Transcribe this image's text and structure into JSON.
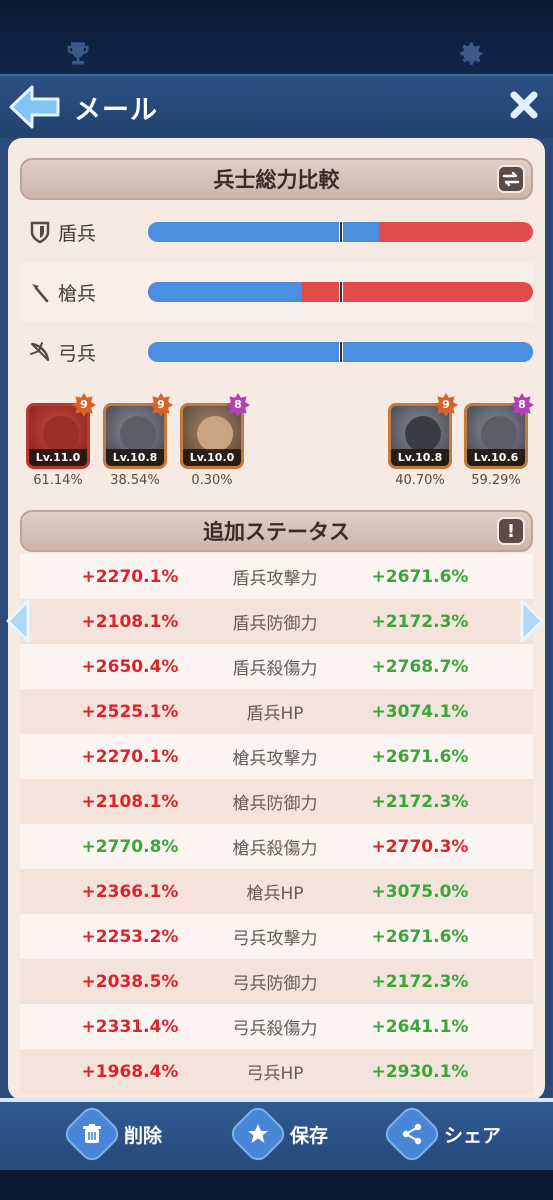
{
  "header": {
    "title": "メール"
  },
  "power_section": {
    "title": "兵士総力比較",
    "rows": [
      {
        "label": "盾兵",
        "icon": "shield-icon",
        "left_share": 0.6
      },
      {
        "label": "槍兵",
        "icon": "spear-icon",
        "left_share": 0.4
      },
      {
        "label": "弓兵",
        "icon": "bow-icon",
        "left_share": 1.0
      }
    ]
  },
  "heroes": {
    "left": [
      {
        "level": "Lv.11.0",
        "stars": "9",
        "pct": "61.14%",
        "star_color": "orange"
      },
      {
        "level": "Lv.10.8",
        "stars": "9",
        "pct": "38.54%",
        "star_color": "orange"
      },
      {
        "level": "Lv.10.0",
        "stars": "8",
        "pct": "0.30%",
        "star_color": "purple"
      }
    ],
    "right": [
      {
        "level": "Lv.10.8",
        "stars": "9",
        "pct": "40.70%",
        "star_color": "orange"
      },
      {
        "level": "Lv.10.6",
        "stars": "8",
        "pct": "59.29%",
        "star_color": "purple"
      }
    ]
  },
  "stats_section": {
    "title": "追加ステータス",
    "rows": [
      {
        "left": "+2270.1%",
        "name": "盾兵攻撃力",
        "right": "+2671.6%",
        "left_color": "red",
        "right_color": "green"
      },
      {
        "left": "+2108.1%",
        "name": "盾兵防御力",
        "right": "+2172.3%",
        "left_color": "red",
        "right_color": "green"
      },
      {
        "left": "+2650.4%",
        "name": "盾兵殺傷力",
        "right": "+2768.7%",
        "left_color": "red",
        "right_color": "green"
      },
      {
        "left": "+2525.1%",
        "name": "盾兵HP",
        "right": "+3074.1%",
        "left_color": "red",
        "right_color": "green"
      },
      {
        "left": "+2270.1%",
        "name": "槍兵攻撃力",
        "right": "+2671.6%",
        "left_color": "red",
        "right_color": "green"
      },
      {
        "left": "+2108.1%",
        "name": "槍兵防御力",
        "right": "+2172.3%",
        "left_color": "red",
        "right_color": "green"
      },
      {
        "left": "+2770.8%",
        "name": "槍兵殺傷力",
        "right": "+2770.3%",
        "left_color": "green",
        "right_color": "red"
      },
      {
        "left": "+2366.1%",
        "name": "槍兵HP",
        "right": "+3075.0%",
        "left_color": "red",
        "right_color": "green"
      },
      {
        "left": "+2253.2%",
        "name": "弓兵攻撃力",
        "right": "+2671.6%",
        "left_color": "red",
        "right_color": "green"
      },
      {
        "left": "+2038.5%",
        "name": "弓兵防御力",
        "right": "+2172.3%",
        "left_color": "red",
        "right_color": "green"
      },
      {
        "left": "+2331.4%",
        "name": "弓兵殺傷力",
        "right": "+2641.1%",
        "left_color": "red",
        "right_color": "green"
      },
      {
        "left": "+1968.4%",
        "name": "弓兵HP",
        "right": "+2930.1%",
        "left_color": "red",
        "right_color": "green"
      }
    ]
  },
  "footer": {
    "delete_label": "削除",
    "save_label": "保存",
    "share_label": "シェア"
  }
}
